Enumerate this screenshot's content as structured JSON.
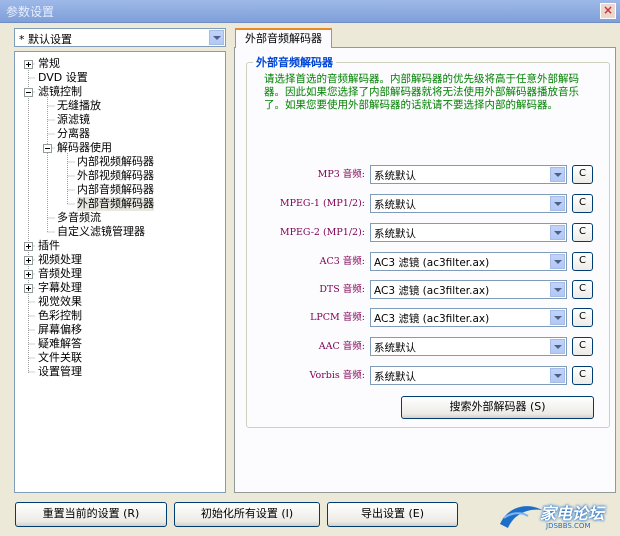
{
  "window": {
    "title": "参数设置",
    "close": "×"
  },
  "preset": {
    "value": "* 默认设置"
  },
  "tree": {
    "items": [
      {
        "label": "常规",
        "level": 0,
        "expander": "plus"
      },
      {
        "label": "DVD 设置",
        "level": 0,
        "expander": ""
      },
      {
        "label": "滤镜控制",
        "level": 0,
        "expander": "minus"
      },
      {
        "label": "无缝播放",
        "level": 1,
        "expander": ""
      },
      {
        "label": "源滤镜",
        "level": 1,
        "expander": ""
      },
      {
        "label": "分离器",
        "level": 1,
        "expander": ""
      },
      {
        "label": "解码器使用",
        "level": 1,
        "expander": "minus"
      },
      {
        "label": "内部视频解码器",
        "level": 2,
        "expander": ""
      },
      {
        "label": "外部视频解码器",
        "level": 2,
        "expander": ""
      },
      {
        "label": "内部音频解码器",
        "level": 2,
        "expander": ""
      },
      {
        "label": "外部音频解码器",
        "level": 2,
        "expander": "",
        "selected": true
      },
      {
        "label": "多音频流",
        "level": 1,
        "expander": ""
      },
      {
        "label": "自定义滤镜管理器",
        "level": 1,
        "expander": ""
      },
      {
        "label": "插件",
        "level": 0,
        "expander": "plus"
      },
      {
        "label": "视频处理",
        "level": 0,
        "expander": "plus"
      },
      {
        "label": "音频处理",
        "level": 0,
        "expander": "plus"
      },
      {
        "label": "字幕处理",
        "level": 0,
        "expander": "plus"
      },
      {
        "label": "视觉效果",
        "level": 0,
        "expander": ""
      },
      {
        "label": "色彩控制",
        "level": 0,
        "expander": ""
      },
      {
        "label": "屏幕偏移",
        "level": 0,
        "expander": ""
      },
      {
        "label": "疑难解答",
        "level": 0,
        "expander": ""
      },
      {
        "label": "文件关联",
        "level": 0,
        "expander": ""
      },
      {
        "label": "设置管理",
        "level": 0,
        "expander": ""
      }
    ]
  },
  "tab": {
    "label": "外部音频解码器"
  },
  "group": {
    "title": "外部音频解码器",
    "description": "请选择首选的音频解码器。内部解码器的优先级将高于任意外部解码器。因此如果您选择了内部解码器就将无法使用外部解码器播放音乐了。如果您要使用外部解码器的话就请不要选择内部的解码器。"
  },
  "decoders": [
    {
      "label": "MP3 音频:",
      "value": "系统默认",
      "button": "C"
    },
    {
      "label": "MPEG-1 (MP1/2):",
      "value": "系统默认",
      "button": "C"
    },
    {
      "label": "MPEG-2 (MP1/2):",
      "value": "系统默认",
      "button": "C"
    },
    {
      "label": "AC3 音频:",
      "value": "AC3 滤镜 (ac3filter.ax)",
      "button": "C"
    },
    {
      "label": "DTS 音频:",
      "value": "AC3 滤镜 (ac3filter.ax)",
      "button": "C"
    },
    {
      "label": "LPCM 音频:",
      "value": "AC3 滤镜 (ac3filter.ax)",
      "button": "C"
    },
    {
      "label": "AAC 音频:",
      "value": "系统默认",
      "button": "C"
    },
    {
      "label": "Vorbis 音频:",
      "value": "系统默认",
      "button": "C"
    }
  ],
  "search_button": "搜索外部解码器 (S)",
  "footer": {
    "reset": "重置当前的设置 (R)",
    "init_all": "初始化所有设置 (I)",
    "export": "导出设置 (E)"
  },
  "watermark": {
    "title": "家电论坛",
    "url": "JDSBBS.COM"
  }
}
